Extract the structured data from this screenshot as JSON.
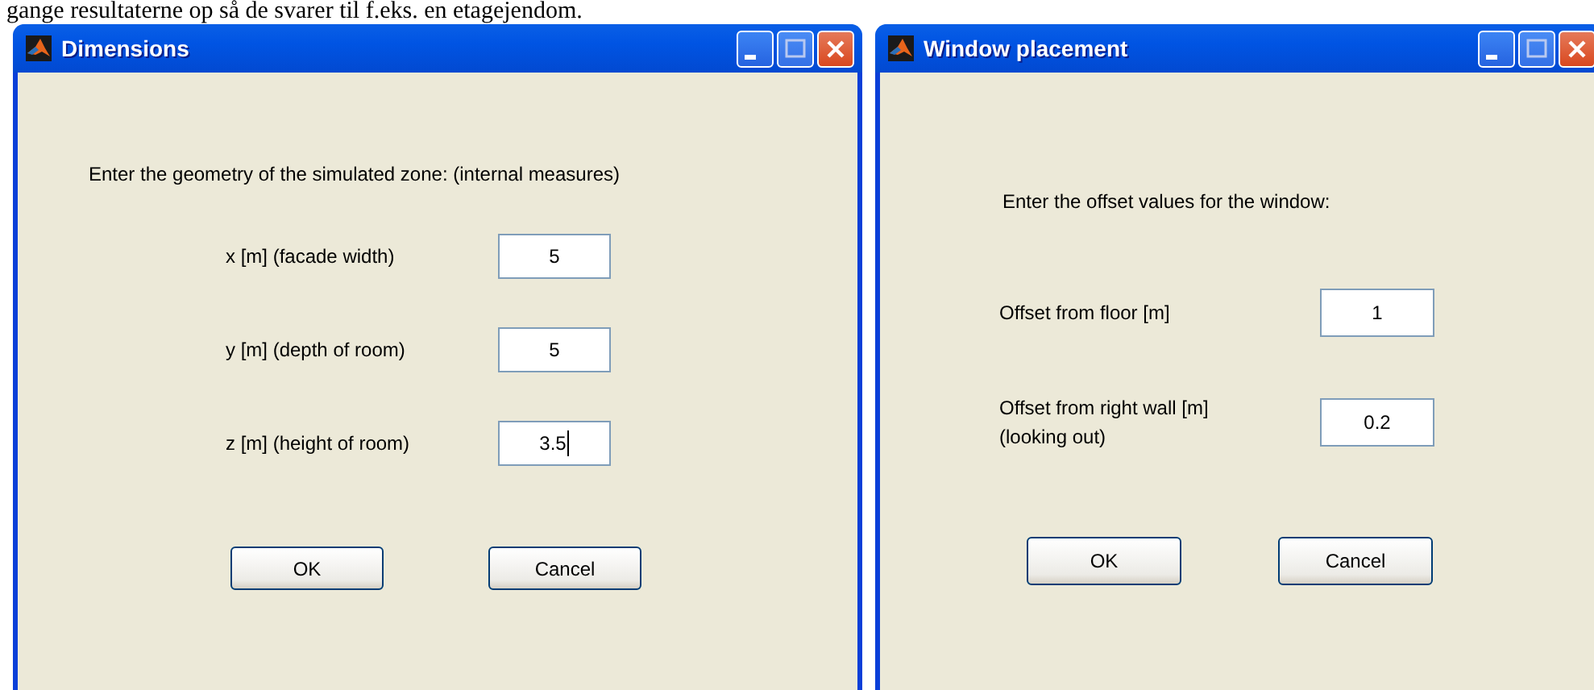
{
  "page_text": "gange resultaterne op så de svarer til f.eks. en etagejendom.",
  "dialogs": [
    {
      "title": "Dimensions",
      "prompt": "Enter the geometry of the simulated zone: (internal measures)",
      "fields": [
        {
          "label": "x [m] (facade width)",
          "value": "5",
          "focused": false
        },
        {
          "label": "y [m] (depth of room)",
          "value": "5",
          "focused": false
        },
        {
          "label": "z [m] (height of room)",
          "value": "3.5",
          "focused": true
        }
      ],
      "buttons": [
        "OK",
        "Cancel"
      ]
    },
    {
      "title": "Window placement",
      "prompt": "Enter the offset values for the window:",
      "fields": [
        {
          "label": "Offset from floor [m]",
          "value": "1",
          "focused": false
        },
        {
          "label": "Offset from right wall [m]\n(looking out)",
          "value": "0.2",
          "focused": false
        }
      ],
      "buttons": [
        "OK",
        "Cancel"
      ]
    }
  ]
}
